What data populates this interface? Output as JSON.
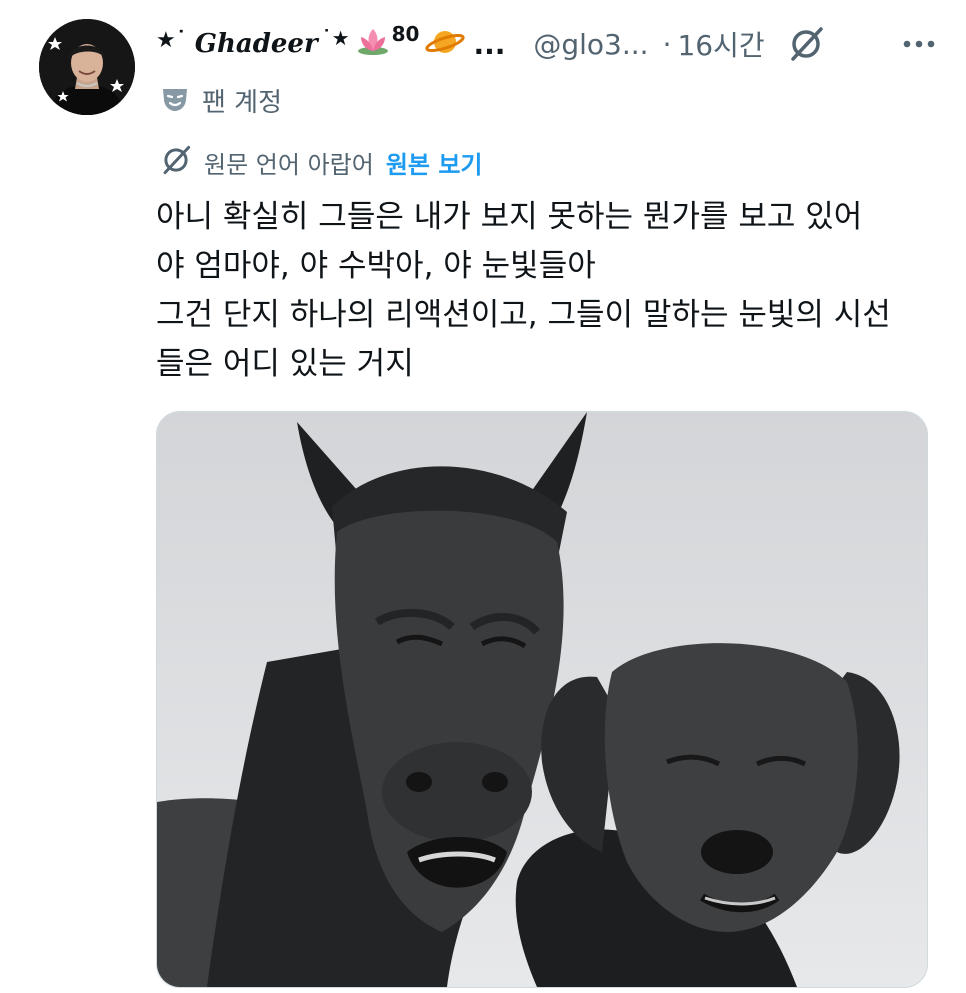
{
  "author": {
    "display_name": "Ghadeer",
    "name_suffix": "80",
    "emojis": [
      "lotus-emoji",
      "planet-emoji"
    ],
    "ellipsis": "...",
    "handle": "@glo3...",
    "separator": "·",
    "time": "16시간",
    "badge": "팬 계정"
  },
  "translation": {
    "text": "원문 언어 아랍어",
    "link": "원본 보기"
  },
  "tweet": {
    "lines": [
      "아니 확실히 그들은 내가 보지 못하는 뭔가를 보고 있어",
      "야 엄마야, 야 수박아, 야 눈빛들아",
      "그건 단지 하나의 리액션이고, 그들이 말하는 눈빛의 시선",
      "들은 어디 있는 거지"
    ]
  },
  "icons": {
    "grok": "grok-icon",
    "more": "more-icon",
    "fan": "theater-mask-icon",
    "translate": "grok-icon"
  },
  "colors": {
    "text": "#0f1419",
    "secondary": "#536471",
    "link": "#1d9bf0"
  }
}
